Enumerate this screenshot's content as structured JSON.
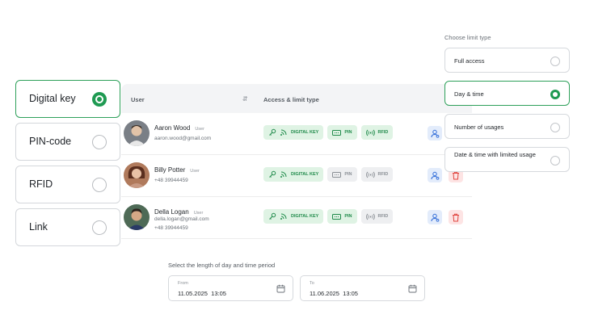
{
  "access_types": [
    {
      "label": "Digital key",
      "selected": true
    },
    {
      "label": "PIN-code",
      "selected": false
    },
    {
      "label": "RFID",
      "selected": false
    },
    {
      "label": "Link",
      "selected": false
    }
  ],
  "table": {
    "col_user": "User",
    "col_access": "Access & limit type",
    "rows": [
      {
        "name": "Aaron Wood",
        "role": "User",
        "line1": "aaron.wood@gmail.com",
        "line2": "",
        "digital_key": true,
        "pin": true,
        "rfid": true
      },
      {
        "name": "Billy Potter",
        "role": "User",
        "line1": "+48 39944459",
        "line2": "",
        "digital_key": true,
        "pin": false,
        "rfid": false
      },
      {
        "name": "Della Logan",
        "role": "User",
        "line1": "della.logan@gmail.com",
        "line2": "+48 39944459",
        "digital_key": true,
        "pin": true,
        "rfid": false
      }
    ],
    "badge_labels": {
      "digital_key": "DIGITAL KEY",
      "pin": "PIN",
      "rfid": "RFID"
    }
  },
  "limit": {
    "title": "Choose limit type",
    "options": [
      {
        "label": "Full access",
        "selected": false
      },
      {
        "label": "Day & time",
        "selected": true
      },
      {
        "label": "Number of usages",
        "selected": false
      },
      {
        "label": "Date & time with limited usage",
        "selected": false
      }
    ]
  },
  "period": {
    "title": "Select the length of day and time period",
    "from_label": "From",
    "from_value": "11.05.2025  13:05",
    "to_label": "To",
    "to_value": "11.06.2025  13:05"
  },
  "colors": {
    "accent": "#1f9a52",
    "badge_on_bg": "#dff3e4",
    "badge_off_bg": "#eeeff1",
    "user_action_bg": "#e3ecfb",
    "delete_action_bg": "#fde4e4"
  },
  "icons": [
    "key-icon",
    "nfc-icon",
    "pin-icon",
    "rfid-icon",
    "user-settings-icon",
    "trash-icon",
    "calendar-icon",
    "sort-icon"
  ]
}
